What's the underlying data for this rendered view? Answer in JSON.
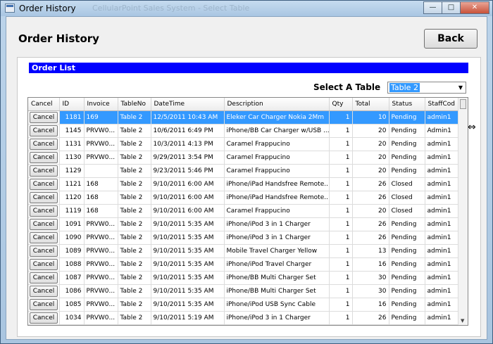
{
  "window": {
    "title": "Order History",
    "ghost_title": "CellularPoint Sales System - Select Table",
    "minimize_glyph": "—",
    "maximize_glyph": "□",
    "close_glyph": "✕"
  },
  "page": {
    "title": "Order History",
    "back_label": "Back"
  },
  "panel": {
    "header": "Order List",
    "select_label": "Select A Table",
    "select_value": "Table 2"
  },
  "grid": {
    "columns": [
      "Cancel",
      "ID",
      "Invoice",
      "TableNo",
      "DateTime",
      "Description",
      "Qty",
      "Total",
      "Status",
      "StaffCod"
    ],
    "cancel_label": "Cancel",
    "rows": [
      {
        "id": "1181",
        "invoice": "169",
        "table": "Table 2",
        "datetime": "12/5/2011 10:43 AM",
        "description": "Eleker Car Charger Nokia 2Mm",
        "qty": "1",
        "total": "10",
        "status": "Pending",
        "staff": "admin1"
      },
      {
        "id": "1145",
        "invoice": "PRVW0...",
        "table": "Table 2",
        "datetime": "10/6/2011 6:49 PM",
        "description": "iPhone/BB Car Charger w/USB ...",
        "qty": "1",
        "total": "20",
        "status": "Pending",
        "staff": "Admin1"
      },
      {
        "id": "1131",
        "invoice": "PRVW0...",
        "table": "Table 2",
        "datetime": "10/3/2011 4:13 PM",
        "description": "Caramel Frappucino",
        "qty": "1",
        "total": "20",
        "status": "Pending",
        "staff": "admin1"
      },
      {
        "id": "1130",
        "invoice": "PRVW0...",
        "table": "Table 2",
        "datetime": "9/29/2011 3:54 PM",
        "description": "Caramel Frappucino",
        "qty": "1",
        "total": "20",
        "status": "Pending",
        "staff": "admin1"
      },
      {
        "id": "1129",
        "invoice": "",
        "table": "Table 2",
        "datetime": "9/23/2011 5:46 PM",
        "description": "Caramel Frappucino",
        "qty": "1",
        "total": "20",
        "status": "Pending",
        "staff": "admin1"
      },
      {
        "id": "1121",
        "invoice": "168",
        "table": "Table 2",
        "datetime": "9/10/2011 6:00 AM",
        "description": "iPhone/iPad Handsfree Remote...",
        "qty": "1",
        "total": "26",
        "status": "Closed",
        "staff": "admin1"
      },
      {
        "id": "1120",
        "invoice": "168",
        "table": "Table 2",
        "datetime": "9/10/2011 6:00 AM",
        "description": "iPhone/iPad Handsfree Remote...",
        "qty": "1",
        "total": "26",
        "status": "Closed",
        "staff": "admin1"
      },
      {
        "id": "1119",
        "invoice": "168",
        "table": "Table 2",
        "datetime": "9/10/2011 6:00 AM",
        "description": "Caramel Frappucino",
        "qty": "1",
        "total": "20",
        "status": "Closed",
        "staff": "admin1"
      },
      {
        "id": "1091",
        "invoice": "PRVW0...",
        "table": "Table 2",
        "datetime": "9/10/2011 5:35 AM",
        "description": "iPhone/iPod 3 in 1 Charger",
        "qty": "1",
        "total": "26",
        "status": "Pending",
        "staff": "admin1"
      },
      {
        "id": "1090",
        "invoice": "PRVW0...",
        "table": "Table 2",
        "datetime": "9/10/2011 5:35 AM",
        "description": "iPhone/iPod 3 in 1 Charger",
        "qty": "1",
        "total": "26",
        "status": "Pending",
        "staff": "admin1"
      },
      {
        "id": "1089",
        "invoice": "PRVW0...",
        "table": "Table 2",
        "datetime": "9/10/2011 5:35 AM",
        "description": "Mobile Travel Charger Yellow",
        "qty": "1",
        "total": "13",
        "status": "Pending",
        "staff": "admin1"
      },
      {
        "id": "1088",
        "invoice": "PRVW0...",
        "table": "Table 2",
        "datetime": "9/10/2011 5:35 AM",
        "description": "iPhone/iPod Travel Charger",
        "qty": "1",
        "total": "16",
        "status": "Pending",
        "staff": "admin1"
      },
      {
        "id": "1087",
        "invoice": "PRVW0...",
        "table": "Table 2",
        "datetime": "9/10/2011 5:35 AM",
        "description": "iPhone/BB Multi Charger Set",
        "qty": "1",
        "total": "30",
        "status": "Pending",
        "staff": "admin1"
      },
      {
        "id": "1086",
        "invoice": "PRVW0...",
        "table": "Table 2",
        "datetime": "9/10/2011 5:35 AM",
        "description": "iPhone/BB Multi Charger Set",
        "qty": "1",
        "total": "30",
        "status": "Pending",
        "staff": "admin1"
      },
      {
        "id": "1085",
        "invoice": "PRVW0...",
        "table": "Table 2",
        "datetime": "9/10/2011 5:35 AM",
        "description": "iPhone/iPod USB Sync Cable",
        "qty": "1",
        "total": "16",
        "status": "Pending",
        "staff": "admin1"
      },
      {
        "id": "1034",
        "invoice": "PRVW0...",
        "table": "Table 2",
        "datetime": "9/10/2011 5:19 AM",
        "description": "iPhone/iPod 3 in 1 Charger",
        "qty": "1",
        "total": "26",
        "status": "Pending",
        "staff": "admin1"
      }
    ]
  }
}
